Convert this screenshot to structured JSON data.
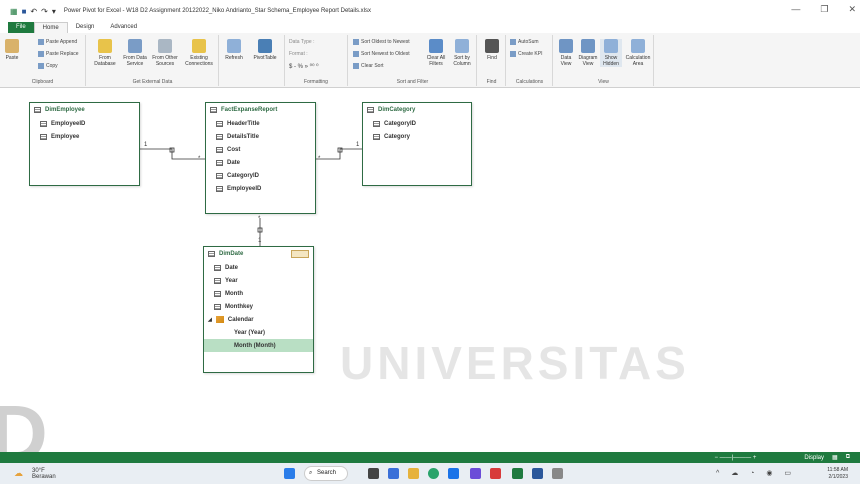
{
  "window": {
    "title": "Power Pivot for Excel - W18 D2 Assignment 20122022_Niko Andrianto_Star Schema_Employee Report Details.xlsx"
  },
  "ribbon_tabs": [
    "File",
    "Home",
    "Design",
    "Advanced"
  ],
  "ribbon": {
    "clipboard": {
      "paste": "Paste",
      "paste_append": "Paste Append",
      "paste_replace": "Paste Replace",
      "copy": "Copy",
      "label": "Clipboard"
    },
    "external": {
      "from_database": "From Database",
      "from_data_service": "From Data Service",
      "from_other_sources": "From Other Sources",
      "existing_connections": "Existing Connections",
      "label": "Get External Data"
    },
    "refresh": "Refresh",
    "pivottable": "PivotTable",
    "formatting": {
      "data_type": "Data Type :",
      "format": "Format :",
      "symbols": "$ - % » ⁰⁰ ⁰",
      "label": "Formatting"
    },
    "sort": {
      "asc": "Sort Oldest to Newest",
      "desc": "Sort Newest to Oldest",
      "clear_sort": "Clear Sort",
      "clear_filters": "Clear All Filters",
      "sort_by_column": "Sort by Column",
      "label": "Sort and Filter"
    },
    "find": {
      "find": "Find",
      "label": "Find"
    },
    "calc": {
      "autosum": "AutoSum",
      "create_kpi": "Create KPI",
      "label": "Calculations"
    },
    "view": {
      "data_view": "Data View",
      "diagram_view": "Diagram View",
      "show_hidden": "Show Hidden",
      "calculation_area": "Calculation Area",
      "label": "View"
    }
  },
  "tables": {
    "dim_employee": {
      "name": "DimEmployee",
      "fields": [
        "EmployeeID",
        "Employee"
      ]
    },
    "fact": {
      "name": "FactExpanseReport",
      "fields": [
        "HeaderTitle",
        "DetailsTitle",
        "Cost",
        "Date",
        "CategoryID",
        "EmployeeID"
      ]
    },
    "dim_category": {
      "name": "DimCategory",
      "fields": [
        "CategoryID",
        "Category"
      ]
    },
    "dim_date": {
      "name": "DimDate",
      "fields": [
        "Date",
        "Year",
        "Month",
        "Monthkey"
      ],
      "hierarchy": "Calendar",
      "hierarchy_levels": [
        "Year (Year)",
        "Month (Month)"
      ]
    }
  },
  "relationships": {
    "one": "1",
    "many": "*"
  },
  "watermark": "UNIVERSITAS",
  "statusbar": {
    "display": "Display"
  },
  "taskbar": {
    "weather_temp": "30°F",
    "weather_text": "Berawan",
    "search": "Search",
    "time": "11:58 AM",
    "date": "2/1/2023"
  }
}
